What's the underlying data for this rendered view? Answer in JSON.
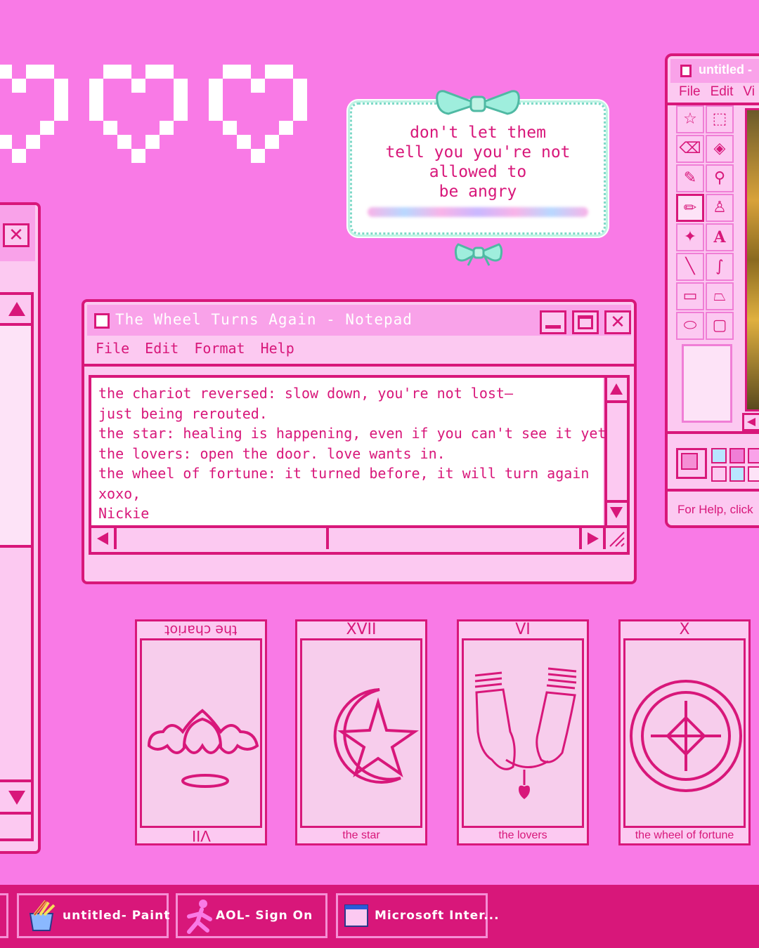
{
  "note": {
    "lines": [
      "don't let them",
      "tell you you're not",
      "allowed to",
      "be angry"
    ]
  },
  "notepad": {
    "title": "The Wheel Turns Again - Notepad",
    "menu": [
      "File",
      "Edit",
      "Format",
      "Help"
    ],
    "lines": [
      "the chariot reversed: slow down, you're not lost—",
      "just being rerouted.",
      "the star: healing is happening, even if you can't see it yet.",
      "the lovers: open the door. love wants in.",
      "the wheel of fortune: it turned before, it will turn again",
      "xoxo,",
      "Nickie"
    ]
  },
  "paint": {
    "title": "untitled -",
    "menu": [
      "File",
      "Edit",
      "Vi"
    ],
    "status": "For Help, click"
  },
  "cards": [
    {
      "numeral": "VII",
      "name": "the chariot",
      "reversed": true
    },
    {
      "numeral": "XVII",
      "name": "the star",
      "reversed": false
    },
    {
      "numeral": "VI",
      "name": "the lovers",
      "reversed": false
    },
    {
      "numeral": "X",
      "name": "the wheel of fortune",
      "reversed": false
    }
  ],
  "taskbar": {
    "items": [
      "untitled- Paint",
      "AOL- Sign On",
      "Microsoft Inter..."
    ]
  },
  "colors": {
    "background": "#f97ae6",
    "accent": "#d8177a",
    "window": "#fcc9f1"
  }
}
